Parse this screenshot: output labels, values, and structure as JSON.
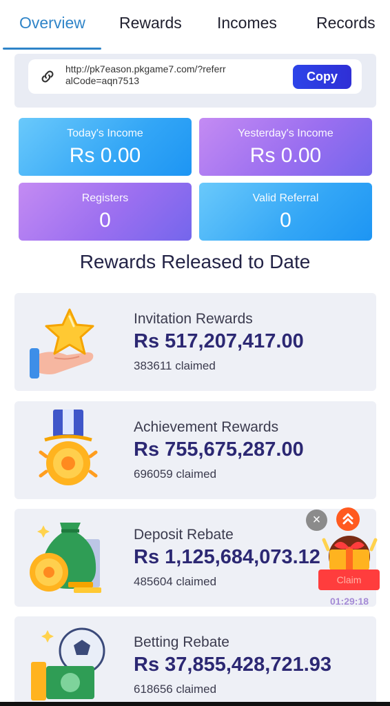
{
  "tabs": [
    {
      "label": "Overview",
      "active": true
    },
    {
      "label": "Rewards",
      "active": false
    },
    {
      "label": "Incomes",
      "active": false
    },
    {
      "label": "Records",
      "active": false
    }
  ],
  "referral": {
    "url": "http://pk7eason.pkgame7.com/?referralCode=aqn7513",
    "copy_label": "Copy"
  },
  "stats": [
    {
      "label": "Today's Income",
      "value": "Rs 0.00"
    },
    {
      "label": "Yesterday's Income",
      "value": "Rs 0.00"
    },
    {
      "label": "Registers",
      "value": "0"
    },
    {
      "label": "Valid Referral",
      "value": "0"
    }
  ],
  "section_title": "Rewards Released to Date",
  "rewards": [
    {
      "title": "Invitation Rewards",
      "amount": "Rs 517,207,417.00",
      "claimed": "383611 claimed",
      "icon": "star-hand-icon"
    },
    {
      "title": "Achievement Rewards",
      "amount": "Rs 755,675,287.00",
      "claimed": "696059 claimed",
      "icon": "medal-icon"
    },
    {
      "title": "Deposit Rebate",
      "amount": "Rs 1,125,684,073.12",
      "claimed": "485604 claimed",
      "icon": "money-bag-icon"
    },
    {
      "title": "Betting Rebate",
      "amount": "Rs 37,855,428,721.93",
      "claimed": "618656 claimed",
      "icon": "cash-ball-icon"
    }
  ],
  "floating_widget": {
    "close": "×",
    "claim_label": "Claim",
    "timer": "01:29:18"
  },
  "colors": {
    "accent": "#2f84c8",
    "copy_button": "#2d44e8",
    "card_blue": "#33a6f6",
    "card_purple": "#9b6ff0",
    "amount_text": "#2c2873"
  }
}
